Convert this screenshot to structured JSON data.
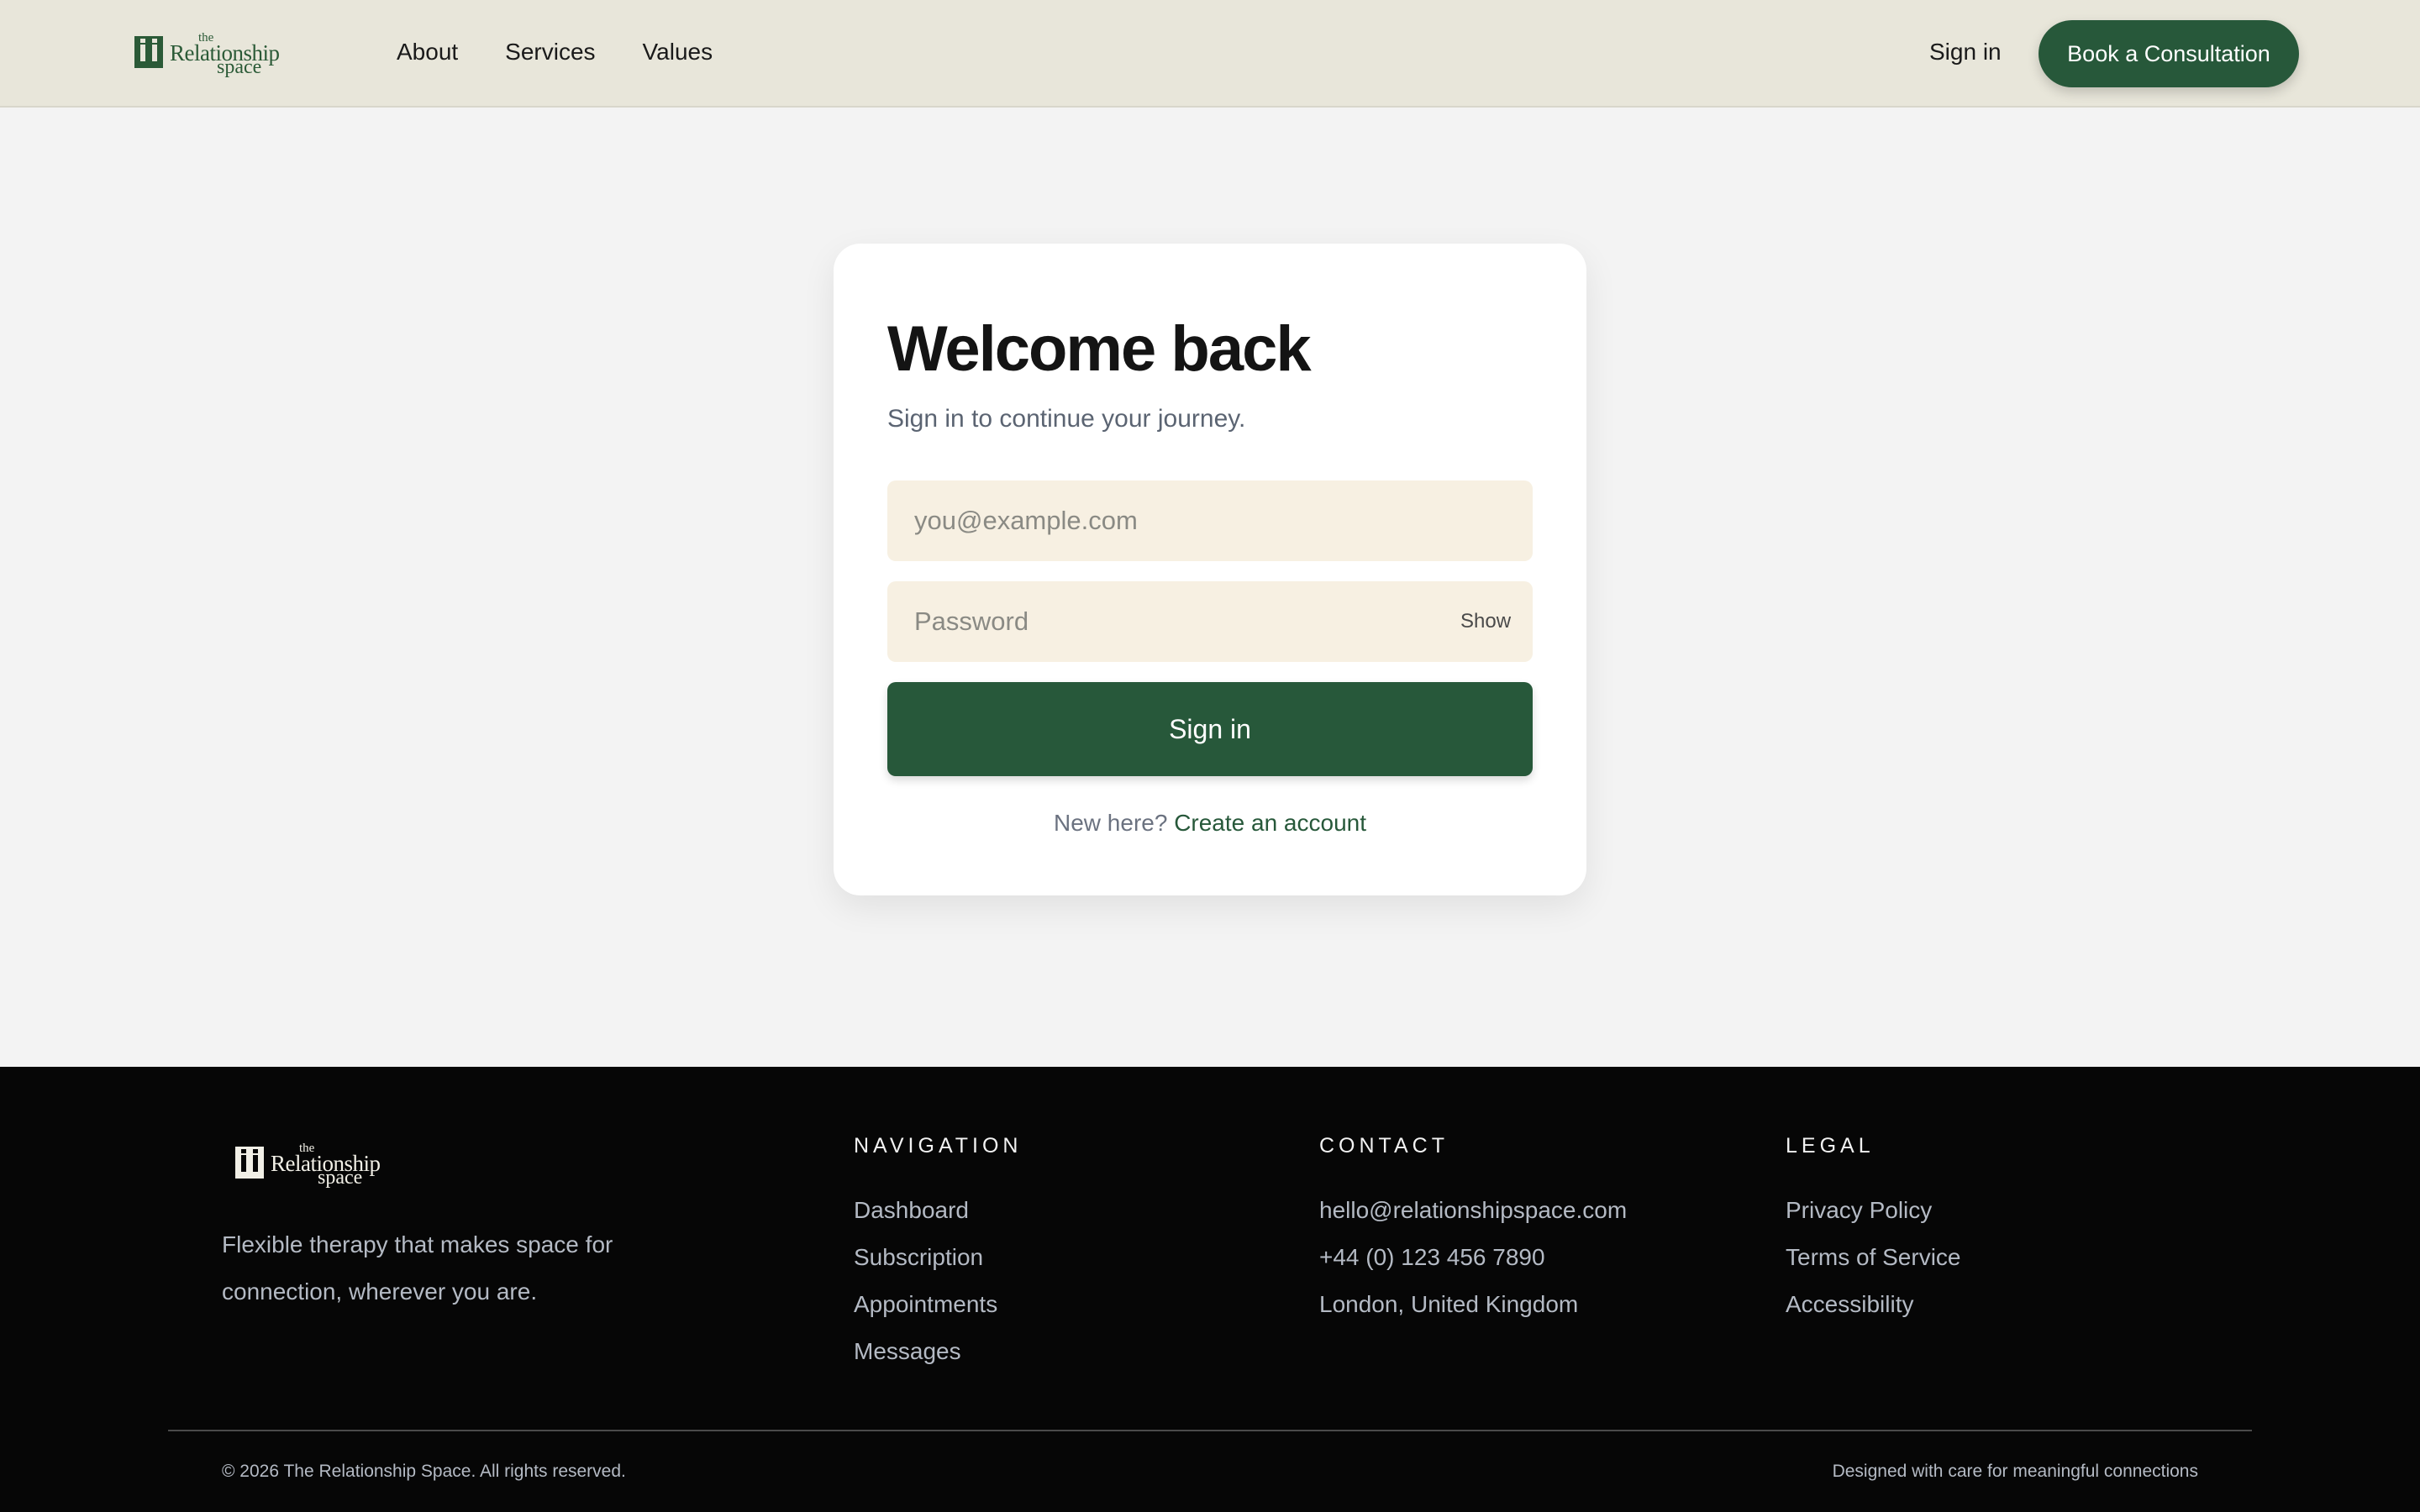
{
  "header": {
    "logo": {
      "small": "the",
      "line1": "Relationship",
      "line2": "space"
    },
    "nav": [
      "About",
      "Services",
      "Values"
    ],
    "sign_in": "Sign in",
    "cta": "Book a Consultation"
  },
  "card": {
    "title": "Welcome back",
    "subtitle": "Sign in to continue your journey.",
    "email_placeholder": "you@example.com",
    "password_placeholder": "Password",
    "show_label": "Show",
    "submit": "Sign in",
    "new_here": "New here?",
    "create_account": "Create an account"
  },
  "footer": {
    "logo": {
      "small": "the",
      "line1": "Relationship",
      "line2": "space"
    },
    "tagline": "Flexible therapy that makes space for connection, wherever you are.",
    "columns": [
      {
        "title": "NAVIGATION",
        "links": [
          "Dashboard",
          "Subscription",
          "Appointments",
          "Messages"
        ]
      },
      {
        "title": "CONTACT",
        "links": [
          "hello@relationshipspace.com",
          "+44 (0) 123 456 7890",
          "London, United Kingdom"
        ]
      },
      {
        "title": "LEGAL",
        "links": [
          "Privacy Policy",
          "Terms of Service",
          "Accessibility"
        ]
      }
    ],
    "copyright": "© 2026 The Relationship Space. All rights reserved.",
    "designed": "Designed with care for meaningful connections"
  },
  "colors": {
    "brand_green": "#27583a",
    "header_bg": "#e8e6da",
    "input_bg": "#f7f0e2",
    "footer_bg": "#060606"
  }
}
